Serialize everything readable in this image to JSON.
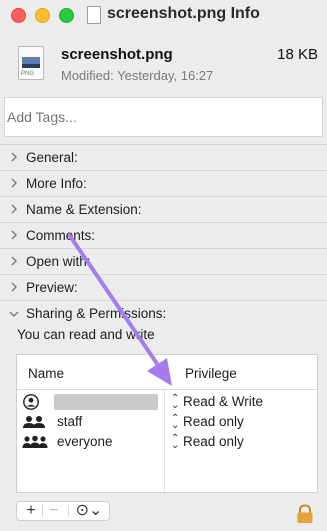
{
  "window": {
    "title": "screenshot.png Info"
  },
  "header": {
    "file_name": "screenshot.png",
    "file_size": "18 KB",
    "modified": "Modified: Yesterday, 16:27",
    "file_icon_ext": "PNG"
  },
  "tags": {
    "placeholder": "Add Tags..."
  },
  "sections": [
    {
      "label": "General:",
      "expanded": false
    },
    {
      "label": "More Info:",
      "expanded": false
    },
    {
      "label": "Name & Extension:",
      "expanded": false
    },
    {
      "label": "Comments:",
      "expanded": false
    },
    {
      "label": "Open with:",
      "expanded": false
    },
    {
      "label": "Preview:",
      "expanded": false
    },
    {
      "label": "Sharing & Permissions:",
      "expanded": true
    }
  ],
  "permissions": {
    "note": "You can read and write",
    "columns": {
      "name": "Name",
      "privilege": "Privilege"
    },
    "rows": [
      {
        "name": "",
        "icon": "user-icon",
        "privilege": "Read & Write",
        "redacted": true
      },
      {
        "name": "staff",
        "icon": "group-icon",
        "privilege": "Read only"
      },
      {
        "name": "everyone",
        "icon": "everyone-icon",
        "privilege": "Read only"
      }
    ]
  },
  "toolbar": {
    "add_label": "+",
    "remove_label": "−",
    "more_label": "⊙⌄"
  },
  "colors": {
    "annotation_arrow": "#a57cf0",
    "lock": "#e3a23b"
  }
}
